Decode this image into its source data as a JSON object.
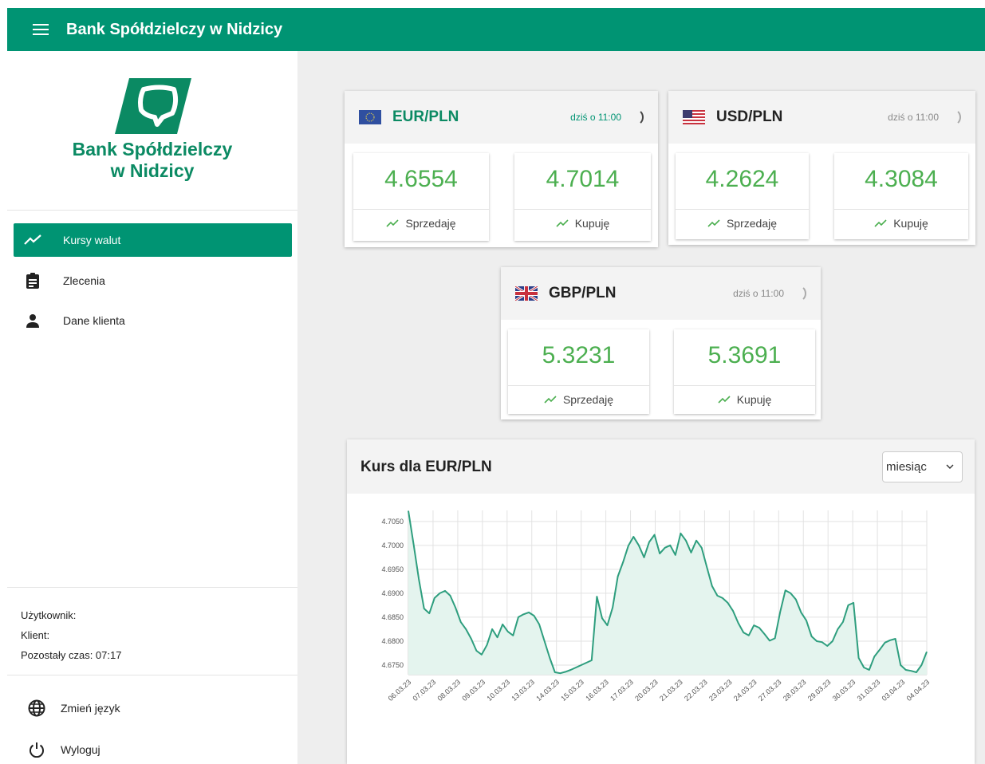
{
  "header": {
    "title": "Bank Spółdzielczy w Nidzicy"
  },
  "sidebar": {
    "logo_line1": "Bank Spółdzielczy",
    "logo_line2": "w Nidzicy",
    "items": [
      {
        "label": "Kursy walut",
        "icon": "trend-icon",
        "active": true
      },
      {
        "label": "Zlecenia",
        "icon": "clipboard-icon"
      },
      {
        "label": "Dane klienta",
        "icon": "person-icon"
      }
    ],
    "user_label": "Użytkownik:",
    "client_label": "Klient:",
    "remaining_time": "Pozostały czas: 07:17",
    "change_language": "Zmień język",
    "logout": "Wyloguj"
  },
  "cards": [
    {
      "pair": "EUR/PLN",
      "time": "dziś o 11:00",
      "sell": "4.6554",
      "buy": "4.7014",
      "sell_label": "Sprzedaję",
      "buy_label": "Kupuję"
    },
    {
      "pair": "USD/PLN",
      "time": "dziś o 11:00",
      "sell": "4.2624",
      "buy": "4.3084",
      "sell_label": "Sprzedaję",
      "buy_label": "Kupuję"
    },
    {
      "pair": "GBP/PLN",
      "time": "dziś o 11:00",
      "sell": "5.3231",
      "buy": "5.3691",
      "sell_label": "Sprzedaję",
      "buy_label": "Kupuję"
    }
  ],
  "chart_section": {
    "title": "Kurs dla EUR/PLN",
    "period": "miesiąc"
  },
  "colors": {
    "primary": "#009473",
    "value_green": "#4caf50",
    "line": "#2e9e7e",
    "fill": "#e4f4ee",
    "time_active": "#009473",
    "time_inactive": "#888888"
  },
  "chart_data": {
    "type": "line",
    "title": "",
    "ylim": [
      4.673,
      4.7073
    ],
    "yticks": [
      "4.7050",
      "4.7000",
      "4.6950",
      "4.6900",
      "4.6850",
      "4.6800",
      "4.6750"
    ],
    "xticks": [
      "06.03.23",
      "07.03.23",
      "08.03.23",
      "09.03.23",
      "10.03.23",
      "13.03.23",
      "14.03.23",
      "15.03.23",
      "16.03.23",
      "17.03.23",
      "20.03.23",
      "21.03.23",
      "22.03.23",
      "23.03.23",
      "24.03.23",
      "27.03.23",
      "28.03.23",
      "29.03.23",
      "30.03.23",
      "31.03.23",
      "03.04.23",
      "04.04.23"
    ],
    "grid": true,
    "values": [
      4.7072,
      4.7002,
      4.693,
      4.6868,
      4.6858,
      4.689,
      4.69,
      4.6905,
      4.6895,
      4.687,
      4.684,
      4.6825,
      4.6805,
      4.678,
      4.6772,
      4.6792,
      4.6825,
      4.6808,
      4.6835,
      4.682,
      4.6812,
      4.685,
      4.6856,
      4.686,
      4.6853,
      4.6835,
      4.68,
      4.6765,
      4.6735,
      4.6733,
      4.6736,
      4.674,
      4.6745,
      4.675,
      4.6755,
      4.676,
      4.6893,
      4.6848,
      4.6833,
      4.687,
      4.6935,
      4.6965,
      4.6999,
      4.7018,
      4.7,
      4.6975,
      4.7007,
      4.7022,
      4.6983,
      4.6995,
      4.7,
      4.698,
      4.7025,
      4.701,
      4.6985,
      4.701,
      4.6995,
      4.6955,
      4.6915,
      4.6895,
      4.689,
      4.688,
      4.6863,
      4.6838,
      4.6818,
      4.6812,
      4.6833,
      4.6828,
      4.6815,
      4.6801,
      4.6806,
      4.6861,
      4.6906,
      4.69,
      4.6887,
      4.686,
      4.6843,
      4.681,
      4.68,
      4.6798,
      4.679,
      4.68,
      4.6825,
      4.684,
      4.6875,
      4.688,
      4.6765,
      4.6745,
      4.674,
      4.6768,
      4.6782,
      4.6797,
      4.6802,
      4.6805,
      4.675,
      4.674,
      4.6738,
      4.6735,
      4.675,
      4.6778
    ]
  }
}
